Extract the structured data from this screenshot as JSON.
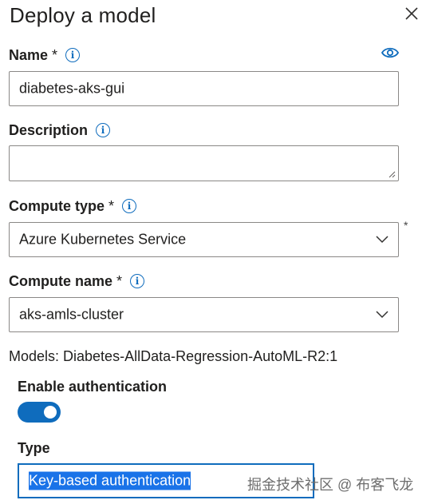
{
  "panel": {
    "title": "Deploy a model",
    "close_icon": "close-icon"
  },
  "name": {
    "label": "Name",
    "required": "*",
    "value": "diabetes-aks-gui",
    "info_icon": "info-icon",
    "eye_icon": "eye-icon"
  },
  "description": {
    "label": "Description",
    "value": "",
    "info_icon": "info-icon"
  },
  "compute_type": {
    "label": "Compute type",
    "required": "*",
    "selected": "Azure Kubernetes Service",
    "side_marker": "*"
  },
  "compute_name": {
    "label": "Compute name",
    "required": "*",
    "selected": "aks-amls-cluster"
  },
  "models": {
    "text": "Models: Diabetes-AllData-Regression-AutoML-R2:1"
  },
  "authentication": {
    "label": "Enable authentication",
    "enabled": true
  },
  "type": {
    "label": "Type",
    "selected": "Key-based authentication"
  },
  "watermark": "掘金技术社区 @ 布客飞龙",
  "colors": {
    "accent": "#0f6cbd",
    "selection": "#1a73e8",
    "border": "#8a8886",
    "text": "#201f1e"
  }
}
